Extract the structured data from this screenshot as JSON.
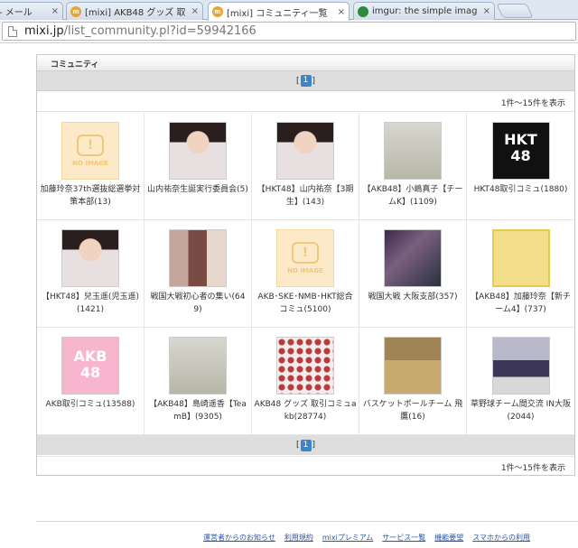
{
  "browser": {
    "tabs": [
      {
        "title": "- メール",
        "icon": "mail-icon"
      },
      {
        "title": "[mixi] AKB48 グッズ 取",
        "icon": "mixi-icon"
      },
      {
        "title": "[mixi] コミュニティ一覧",
        "icon": "mixi-icon",
        "active": true
      },
      {
        "title": "imgur: the simple imag",
        "icon": "imgur-icon"
      }
    ],
    "address_domain": "mixi.jp",
    "address_path": "/list_community.pl?id=59942166"
  },
  "section_title": "コミュニティ",
  "pager": {
    "left": "[",
    "current": "1",
    "right": "]"
  },
  "count_text": "1件～15件を表示",
  "noimage_text": "NO IMAGE",
  "communities": [
    {
      "name": "加藤玲奈37th選抜総選挙対策本部(13)",
      "thumb": "noimage"
    },
    {
      "name": "山内祐奈生誕実行委員会(5)",
      "thumb": "ph-person"
    },
    {
      "name": "【HKT48】山内祐奈【3期生】(143)",
      "thumb": "ph-person"
    },
    {
      "name": "【AKB48】小嶋真子【チームK】(1109)",
      "thumb": "ph-light"
    },
    {
      "name": "HKT48取引コミュ(1880)",
      "thumb": "ph-hkt"
    },
    {
      "name": "【HKT48】兒玉遥(児玉遥)(1421)",
      "thumb": "ph-person"
    },
    {
      "name": "戦国大戦初心者の集い(649)",
      "thumb": "ph-collage"
    },
    {
      "name": "AKB･SKE･NMB･HKT総合コミュ(5100)",
      "thumb": "noimage"
    },
    {
      "name": "戦国大戦 大阪支部(357)",
      "thumb": "ph-dark"
    },
    {
      "name": "【AKB48】加藤玲奈【新チーム4】(737)",
      "thumb": "ph-yellow"
    },
    {
      "name": "AKB取引コミュ(13588)",
      "thumb": "ph-pink"
    },
    {
      "name": "【AKB48】島崎遥香【TeamB】(9305)",
      "thumb": "ph-light"
    },
    {
      "name": "AKB48 グッズ 取引コミュakb(28774)",
      "thumb": "ph-group"
    },
    {
      "name": "バスケットボールチーム 飛鷹(16)",
      "thumb": "ph-gym"
    },
    {
      "name": "草野球チーム間交流 IN大阪(2044)",
      "thumb": "ph-team"
    }
  ],
  "hkt_logo_lines": [
    "HKT",
    "48"
  ],
  "akb_logo_lines": [
    "AKB",
    "48"
  ],
  "footer_links": [
    "運営者からのお知らせ",
    "利用規約",
    "mixiプレミアム",
    "サービス一覧",
    "機能要望",
    "スマホからの利用"
  ]
}
